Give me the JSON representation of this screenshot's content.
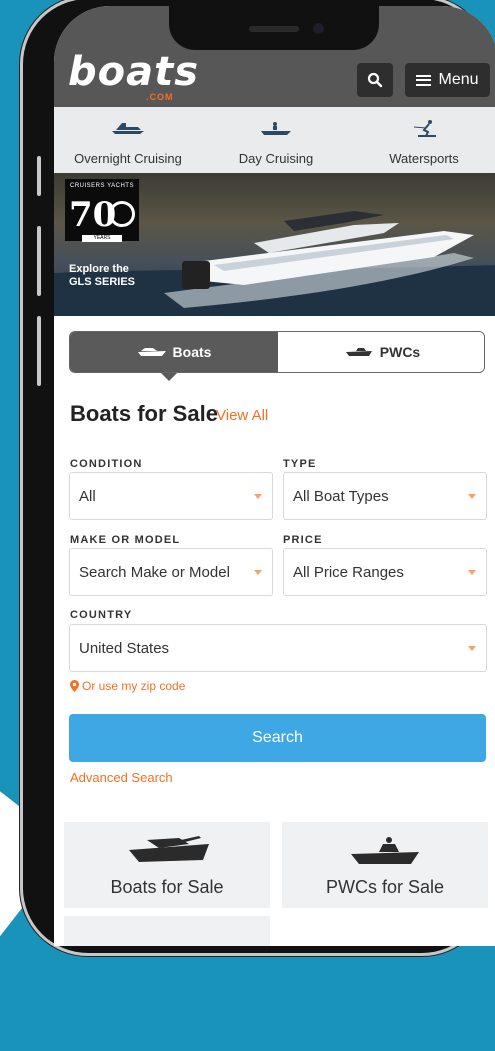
{
  "header": {
    "logo_text": "boats",
    "logo_suffix": ".COM",
    "menu_label": "Menu"
  },
  "categories": [
    {
      "label": "Overnight Cruising",
      "icon": "cruiser-boat-icon"
    },
    {
      "label": "Day Cruising",
      "icon": "day-boat-icon"
    },
    {
      "label": "Watersports",
      "icon": "water-skier-icon"
    }
  ],
  "hero": {
    "badge_top": "CRUISERS YACHTS",
    "badge_number": "70",
    "badge_years": "YEARS",
    "text_line1": "Explore the",
    "text_line2": "GLS SERIES"
  },
  "tabs": {
    "boats": "Boats",
    "pwcs": "PWCs",
    "active": "Boats"
  },
  "search_form": {
    "heading": "Boats for Sale",
    "view_all": "View All",
    "condition_label": "CONDITION",
    "condition_value": "All",
    "type_label": "TYPE",
    "type_value": "All Boat Types",
    "make_label": "MAKE OR MODEL",
    "make_value": "Search Make or Model",
    "price_label": "PRICE",
    "price_value": "All Price Ranges",
    "country_label": "COUNTRY",
    "country_value": "United States",
    "zip_link": "Or use my zip code",
    "search_button": "Search",
    "advanced_link": "Advanced Search"
  },
  "cards": [
    {
      "label": "Boats for Sale",
      "icon": "boat-silhouette-icon"
    },
    {
      "label": "PWCs for Sale",
      "icon": "pwc-silhouette-icon"
    }
  ],
  "colors": {
    "accent": "#f37021",
    "search_blue": "#3ea8e4",
    "header_gray": "#575757",
    "background_teal": "#1a93bb"
  }
}
